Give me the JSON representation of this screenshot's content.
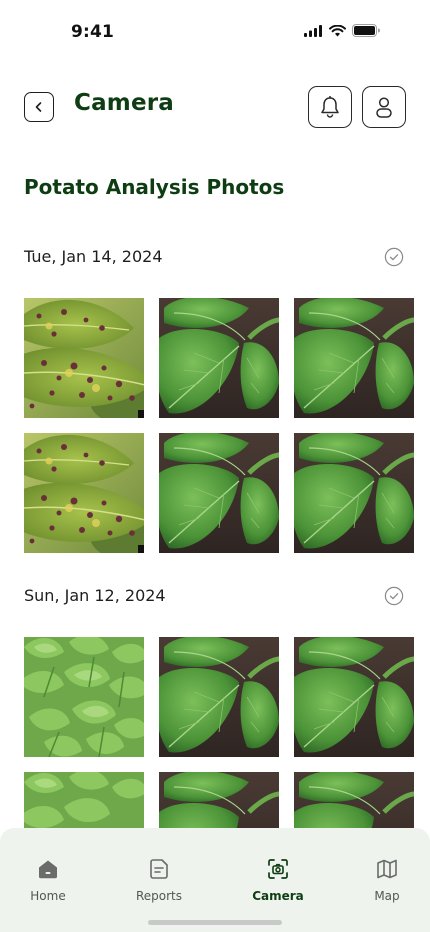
{
  "status_bar": {
    "time": "9:41"
  },
  "header": {
    "title": "Camera"
  },
  "section": {
    "title": "Potato Analysis Photos"
  },
  "groups": [
    {
      "date": "Tue, Jan 14, 2024",
      "photos": [
        "diseased-leaf",
        "healthy-leaf",
        "healthy-leaf",
        "diseased-leaf",
        "healthy-leaf",
        "healthy-leaf"
      ]
    },
    {
      "date": "Sun, Jan 12, 2024",
      "photos": [
        "young-plants",
        "healthy-leaf",
        "healthy-leaf",
        "young-plants",
        "healthy-leaf",
        "healthy-leaf"
      ]
    }
  ],
  "nav": {
    "items": [
      {
        "label": "Home",
        "icon": "home-icon"
      },
      {
        "label": "Reports",
        "icon": "reports-icon"
      },
      {
        "label": "Camera",
        "icon": "camera-icon",
        "active": true
      },
      {
        "label": "Map",
        "icon": "map-icon"
      }
    ]
  },
  "colors": {
    "brand": "#0f3d13",
    "nav_bg": "#eef3ee",
    "leaf_healthy": "#4e9a3c",
    "soil": "#3b2f2a"
  }
}
